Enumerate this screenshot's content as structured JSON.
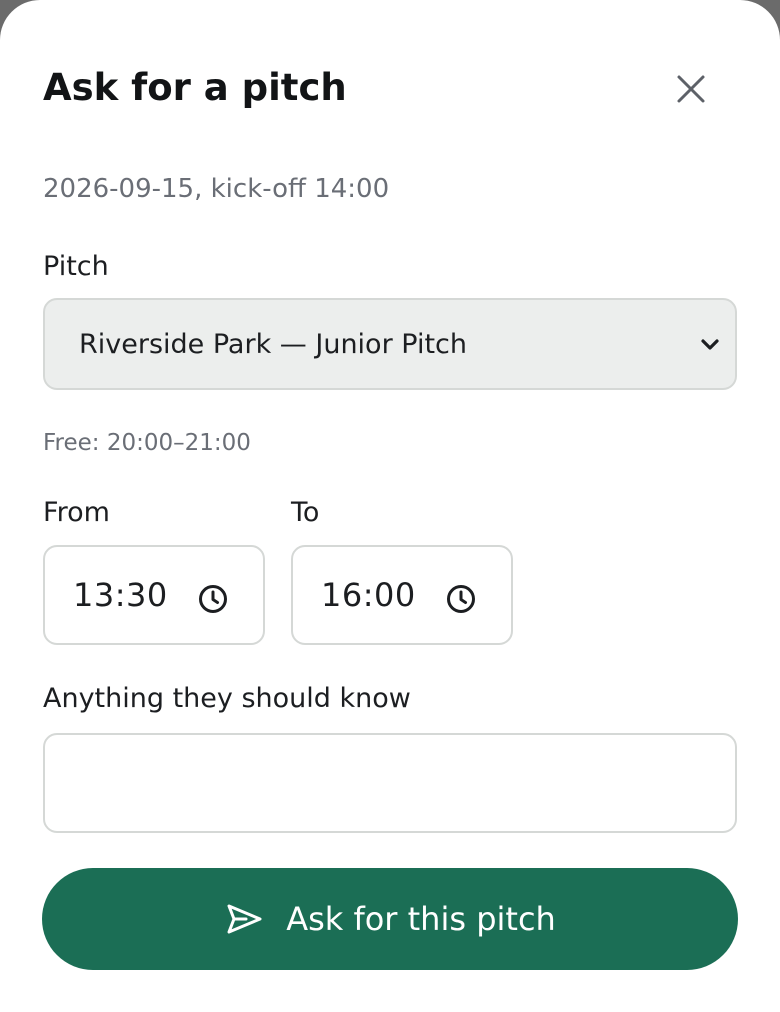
{
  "dialog": {
    "title": "Ask for a pitch",
    "subtitle": "2026-09-15, kick-off 14:00"
  },
  "pitch": {
    "label": "Pitch",
    "selected": "Riverside Park — Junior Pitch",
    "free_hint": "Free: 20:00–21:00"
  },
  "time": {
    "from_label": "From",
    "from_value": "13:30",
    "to_label": "To",
    "to_value": "16:00"
  },
  "note": {
    "label": "Anything they should know",
    "value": "",
    "placeholder": ""
  },
  "submit": {
    "label": "Ask for this pitch"
  },
  "icons": {
    "close": "close-icon",
    "chevron": "chevron-down-icon",
    "clock": "clock-icon",
    "send": "send-icon"
  },
  "colors": {
    "accent": "#1b6e55",
    "select_bg": "#eceeed",
    "muted_text": "#6a6e76"
  }
}
